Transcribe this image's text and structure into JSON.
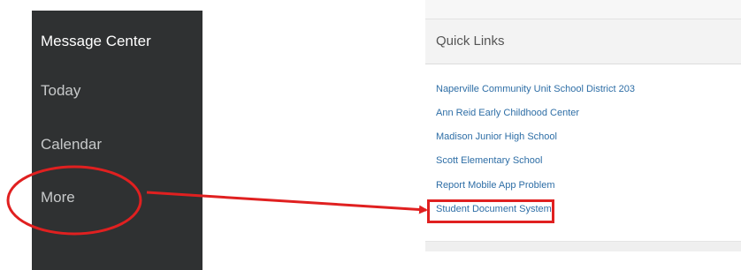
{
  "sidebar": {
    "items": [
      {
        "label": "Message Center"
      },
      {
        "label": "Today"
      },
      {
        "label": "Calendar"
      },
      {
        "label": "More"
      }
    ]
  },
  "quick_links": {
    "title": "Quick Links",
    "links": [
      {
        "label": "Naperville Community Unit School District 203"
      },
      {
        "label": "Ann Reid Early Childhood Center"
      },
      {
        "label": "Madison Junior High School"
      },
      {
        "label": "Scott Elementary School"
      },
      {
        "label": "Report Mobile App Problem"
      },
      {
        "label": "Student Document System"
      }
    ]
  },
  "annotation": {
    "color": "#e02020"
  }
}
